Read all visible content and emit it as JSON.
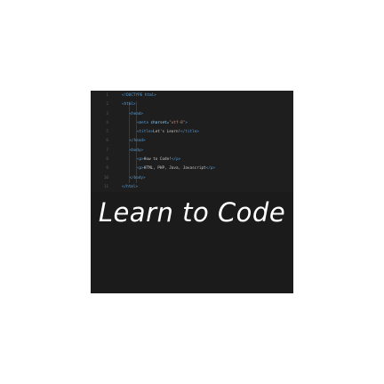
{
  "code_lines": [
    {
      "num": "1",
      "indent": 0,
      "parts": [
        {
          "cls": "tag",
          "t": "<!DOCTYPE html>"
        }
      ]
    },
    {
      "num": "2",
      "indent": 0,
      "parts": [
        {
          "cls": "tag",
          "t": "<html>"
        }
      ]
    },
    {
      "num": "3",
      "indent": 1,
      "parts": [
        {
          "cls": "tag",
          "t": "<head>"
        }
      ]
    },
    {
      "num": "4",
      "indent": 2,
      "parts": [
        {
          "cls": "tag",
          "t": "<meta "
        },
        {
          "cls": "attr",
          "t": "charset="
        },
        {
          "cls": "str",
          "t": "\"utf-8\""
        },
        {
          "cls": "tag",
          "t": ">"
        }
      ]
    },
    {
      "num": "5",
      "indent": 2,
      "parts": [
        {
          "cls": "tag",
          "t": "<title>"
        },
        {
          "cls": "txt",
          "t": "Let's Learn!"
        },
        {
          "cls": "tag",
          "t": "</title>"
        }
      ]
    },
    {
      "num": "6",
      "indent": 1,
      "parts": [
        {
          "cls": "tag",
          "t": "</head>"
        }
      ]
    },
    {
      "num": "7",
      "indent": 1,
      "parts": [
        {
          "cls": "tag",
          "t": "<body>"
        }
      ]
    },
    {
      "num": "8",
      "indent": 2,
      "parts": [
        {
          "cls": "tag",
          "t": "<p>"
        },
        {
          "cls": "txt",
          "t": "How to Code!"
        },
        {
          "cls": "tag",
          "t": "</p>"
        }
      ]
    },
    {
      "num": "9",
      "indent": 2,
      "parts": [
        {
          "cls": "tag",
          "t": "<p>"
        },
        {
          "cls": "txt",
          "t": "HTML, PHP, Java, Javascript"
        },
        {
          "cls": "tag",
          "t": "</p>"
        }
      ]
    },
    {
      "num": "10",
      "indent": 1,
      "parts": [
        {
          "cls": "tag",
          "t": "</body>"
        }
      ]
    },
    {
      "num": "11",
      "indent": 0,
      "parts": [
        {
          "cls": "tag",
          "t": "</html>"
        }
      ]
    }
  ],
  "title": "Learn to Code"
}
